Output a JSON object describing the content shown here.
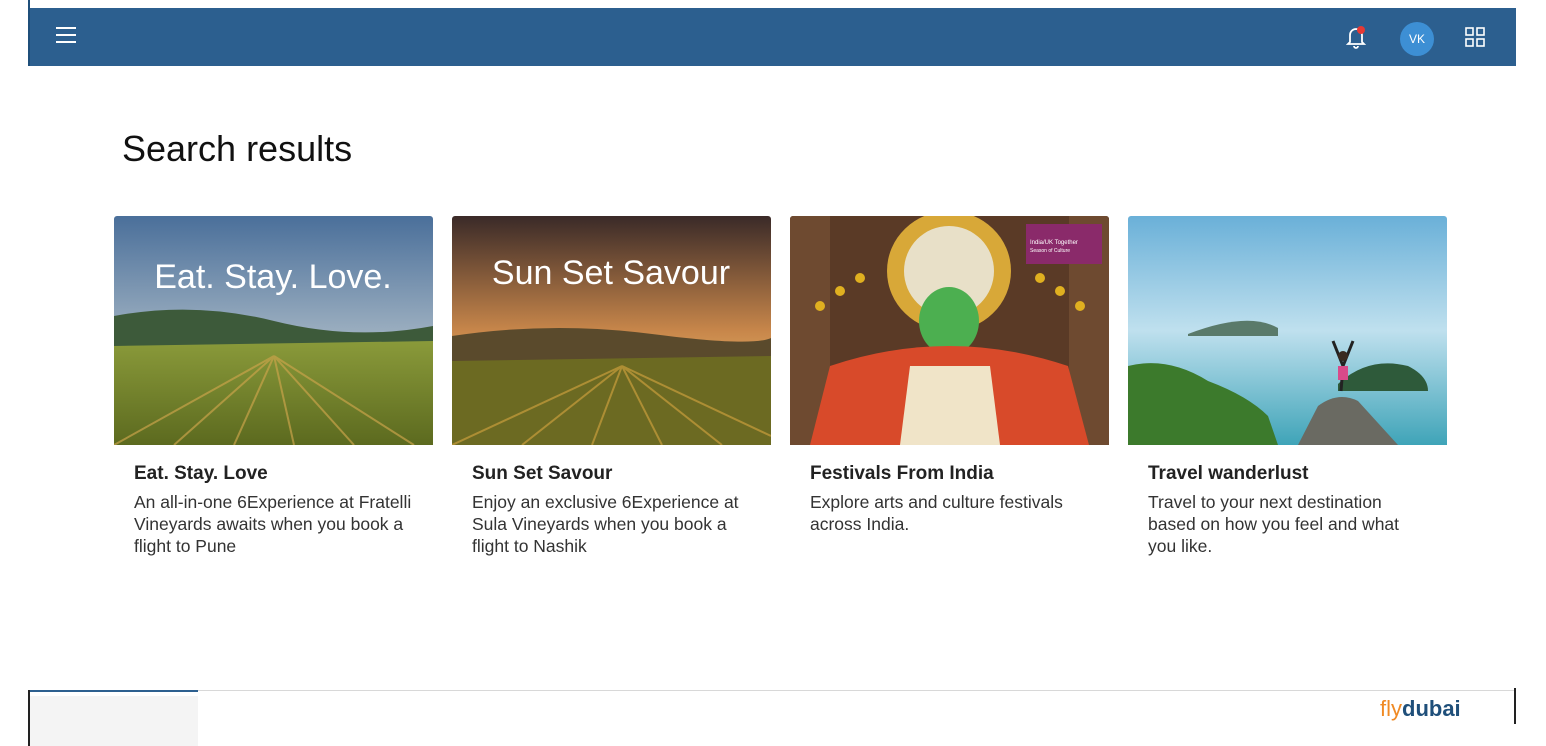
{
  "header": {
    "menu_icon": "hamburger-menu-icon",
    "bell_icon": "notification-bell-icon",
    "avatar_initials": "VK",
    "apps_icon": "apps-grid-icon",
    "brand_color": "#2c5f8f"
  },
  "page": {
    "title": "Search results"
  },
  "cards": [
    {
      "image_text": "Eat. Stay. Love.",
      "title": "Eat. Stay. Love",
      "description": "An all-in-one 6Experience at Fratelli Vineyards awaits when you book a flight to Pune"
    },
    {
      "image_text": "Sun Set Savour",
      "title": "Sun Set Savour",
      "description": "Enjoy an exclusive 6Experience at Sula Vineyards when you book a flight to Nashik"
    },
    {
      "badge_line1": "India/UK Together",
      "badge_line2": "Season of Culture",
      "title": "Festivals From India",
      "description": "Explore arts and culture festivals across India."
    },
    {
      "title": "Travel wanderlust",
      "description": "Travel to your next destination based on how you feel and what you like."
    }
  ],
  "footer": {
    "logo_part1": "fly",
    "logo_part2": "dubai"
  }
}
